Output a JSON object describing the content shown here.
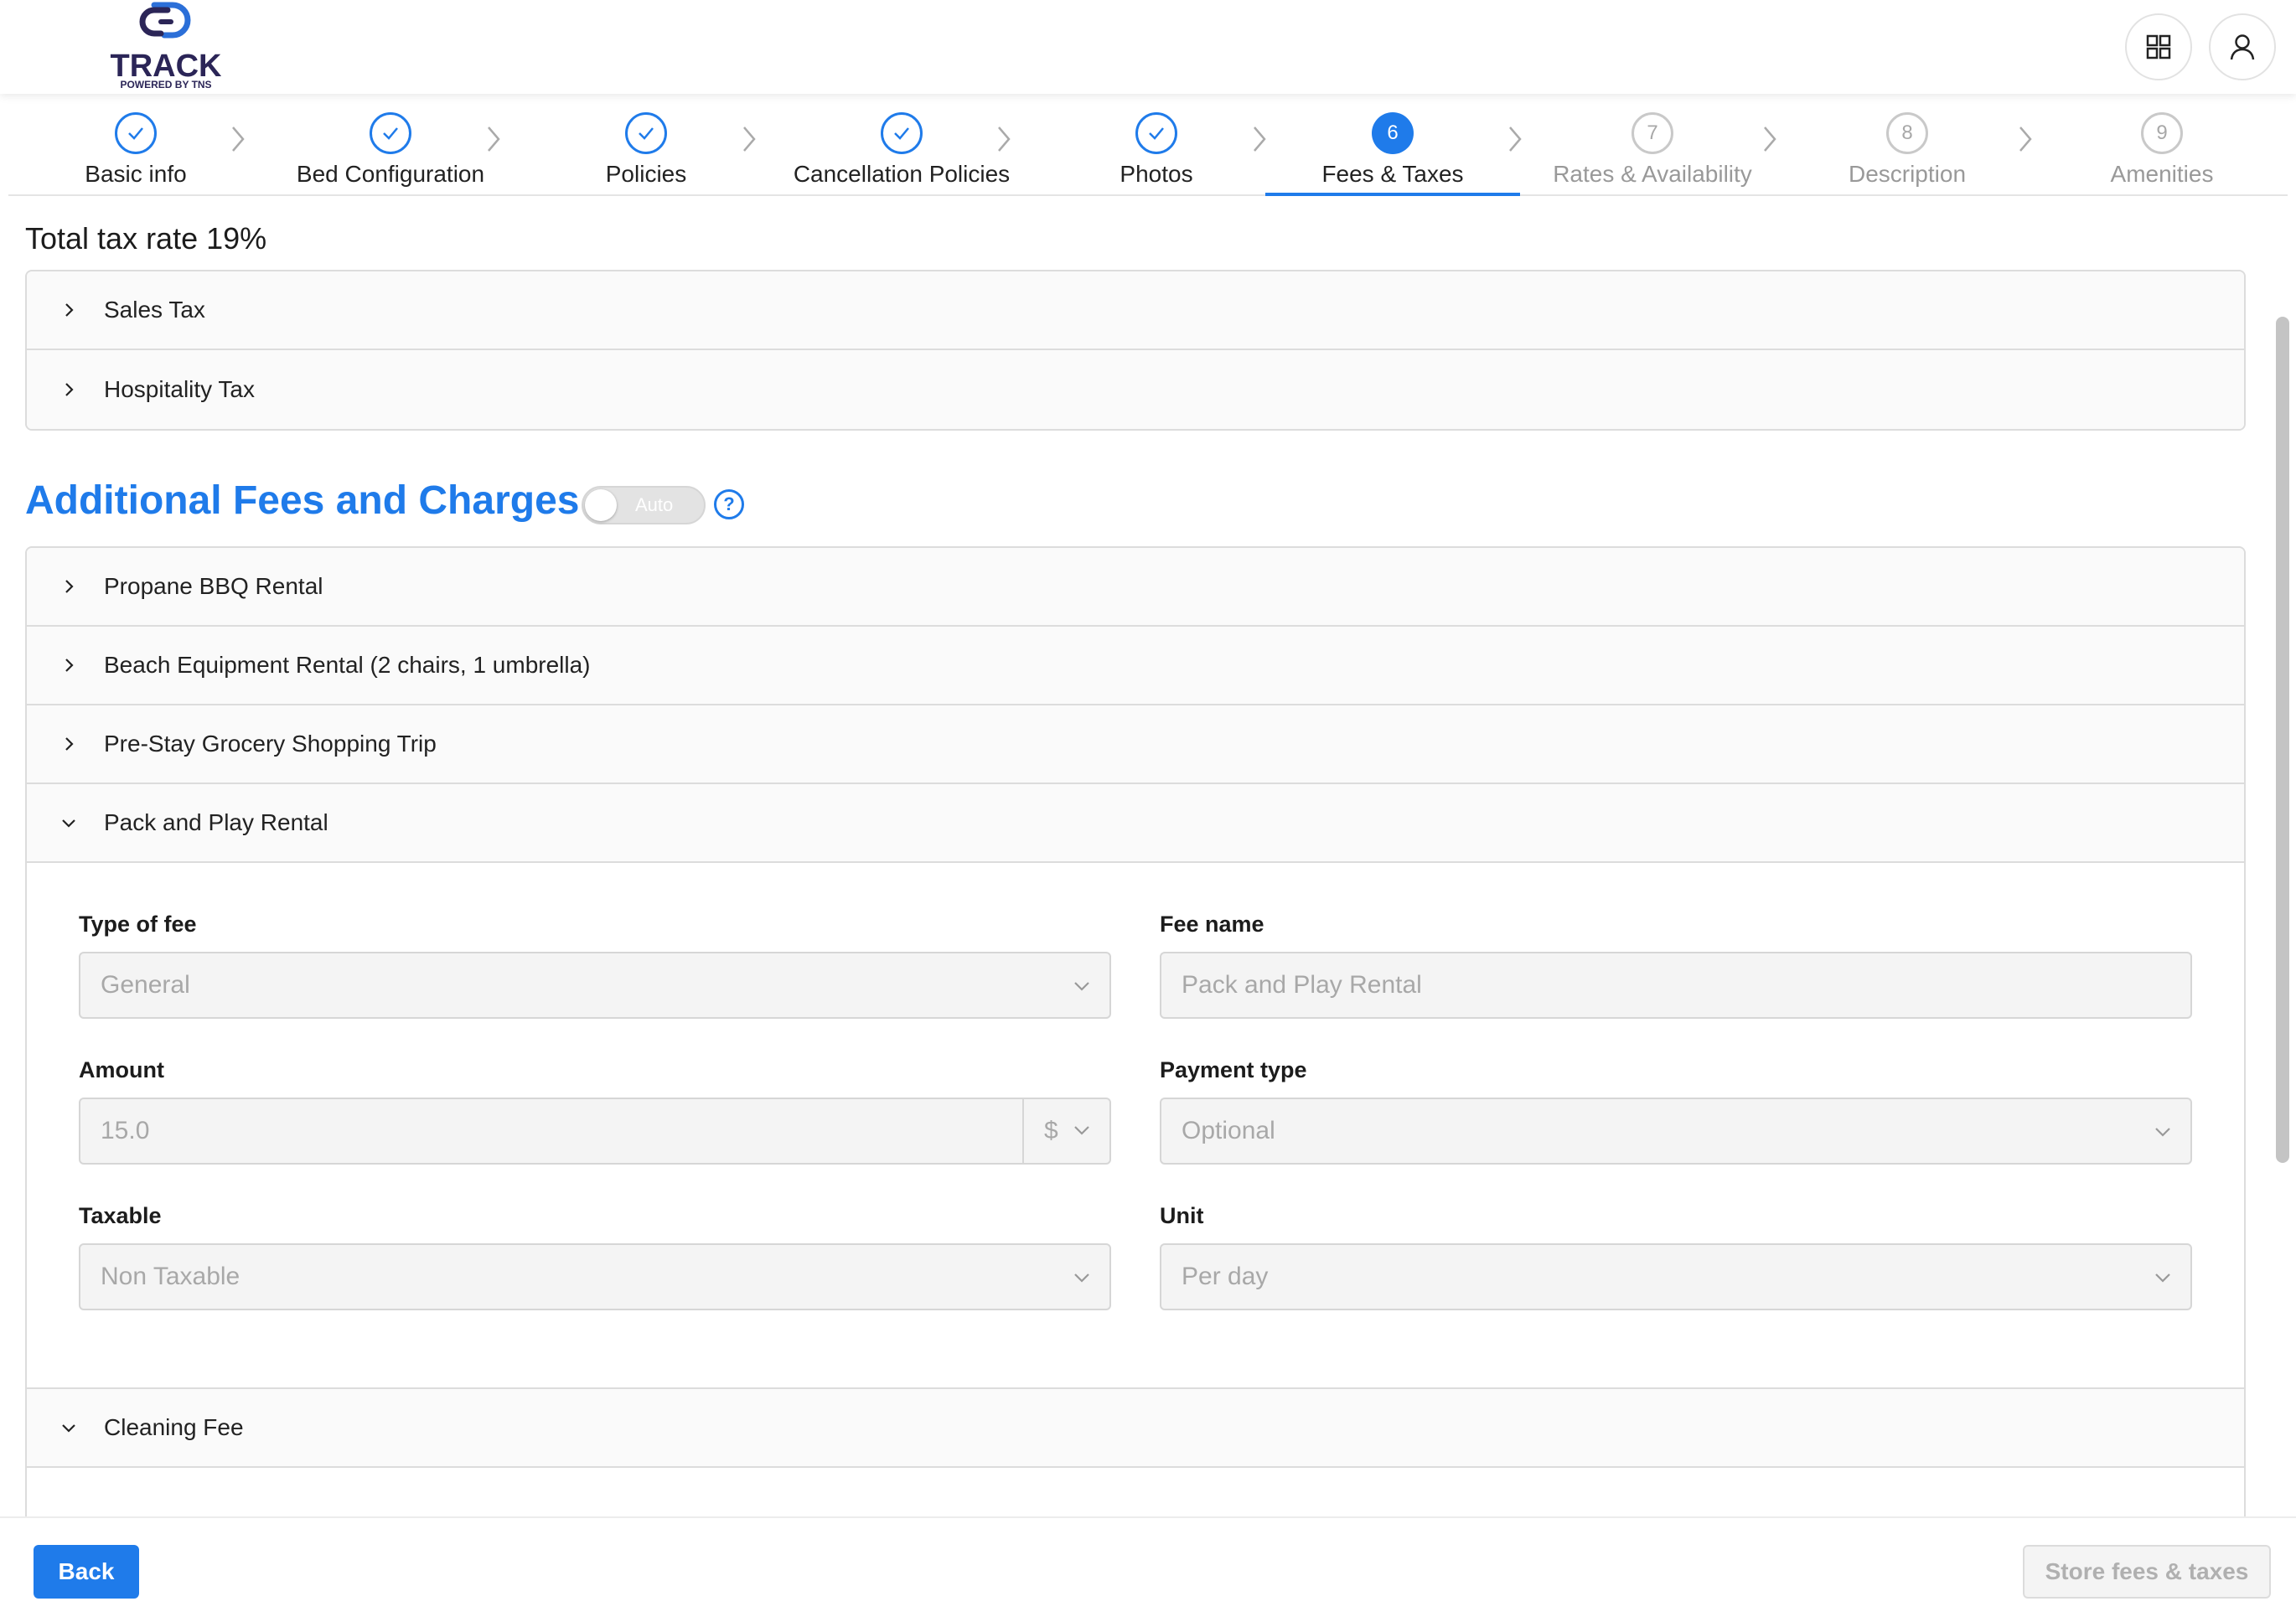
{
  "brand": {
    "name": "TRACK",
    "tagline": "POWERED BY TNS",
    "accent": "#1f7bea",
    "logo_color": "#2b2557"
  },
  "header": {
    "apps_icon": "grid-icon",
    "user_icon": "user-icon"
  },
  "steps": [
    {
      "label": "Basic info",
      "status": "done",
      "number": "1"
    },
    {
      "label": "Bed Configuration",
      "status": "done",
      "number": "2"
    },
    {
      "label": "Policies",
      "status": "done",
      "number": "3"
    },
    {
      "label": "Cancellation Policies",
      "status": "done",
      "number": "4"
    },
    {
      "label": "Photos",
      "status": "done",
      "number": "5"
    },
    {
      "label": "Fees & Taxes",
      "status": "active",
      "number": "6"
    },
    {
      "label": "Rates & Availability",
      "status": "todo",
      "number": "7"
    },
    {
      "label": "Description",
      "status": "todo",
      "number": "8"
    },
    {
      "label": "Amenities",
      "status": "todo",
      "number": "9"
    }
  ],
  "taxes": {
    "total_label": "Total tax rate 19%",
    "items": [
      "Sales Tax",
      "Hospitality Tax"
    ]
  },
  "fees": {
    "title": "Additional Fees and Charges",
    "auto_toggle": {
      "label": "Auto",
      "on": false
    },
    "help": "?",
    "items": [
      {
        "label": "Propane BBQ Rental",
        "expanded": false
      },
      {
        "label": "Beach Equipment Rental (2 chairs, 1 umbrella)",
        "expanded": false
      },
      {
        "label": "Pre-Stay Grocery Shopping Trip",
        "expanded": false
      },
      {
        "label": "Pack and Play Rental",
        "expanded": true
      },
      {
        "label": "Cleaning Fee",
        "expanded": true
      }
    ],
    "form": {
      "type_of_fee": {
        "label": "Type of fee",
        "value": "General"
      },
      "fee_name": {
        "label": "Fee name",
        "value": "Pack and Play Rental"
      },
      "amount": {
        "label": "Amount",
        "value": "15.0",
        "currency": "$"
      },
      "payment_type": {
        "label": "Payment type",
        "value": "Optional"
      },
      "taxable": {
        "label": "Taxable",
        "value": "Non Taxable"
      },
      "unit": {
        "label": "Unit",
        "value": "Per day"
      }
    }
  },
  "footer": {
    "back_label": "Back",
    "store_label": "Store fees & taxes"
  }
}
